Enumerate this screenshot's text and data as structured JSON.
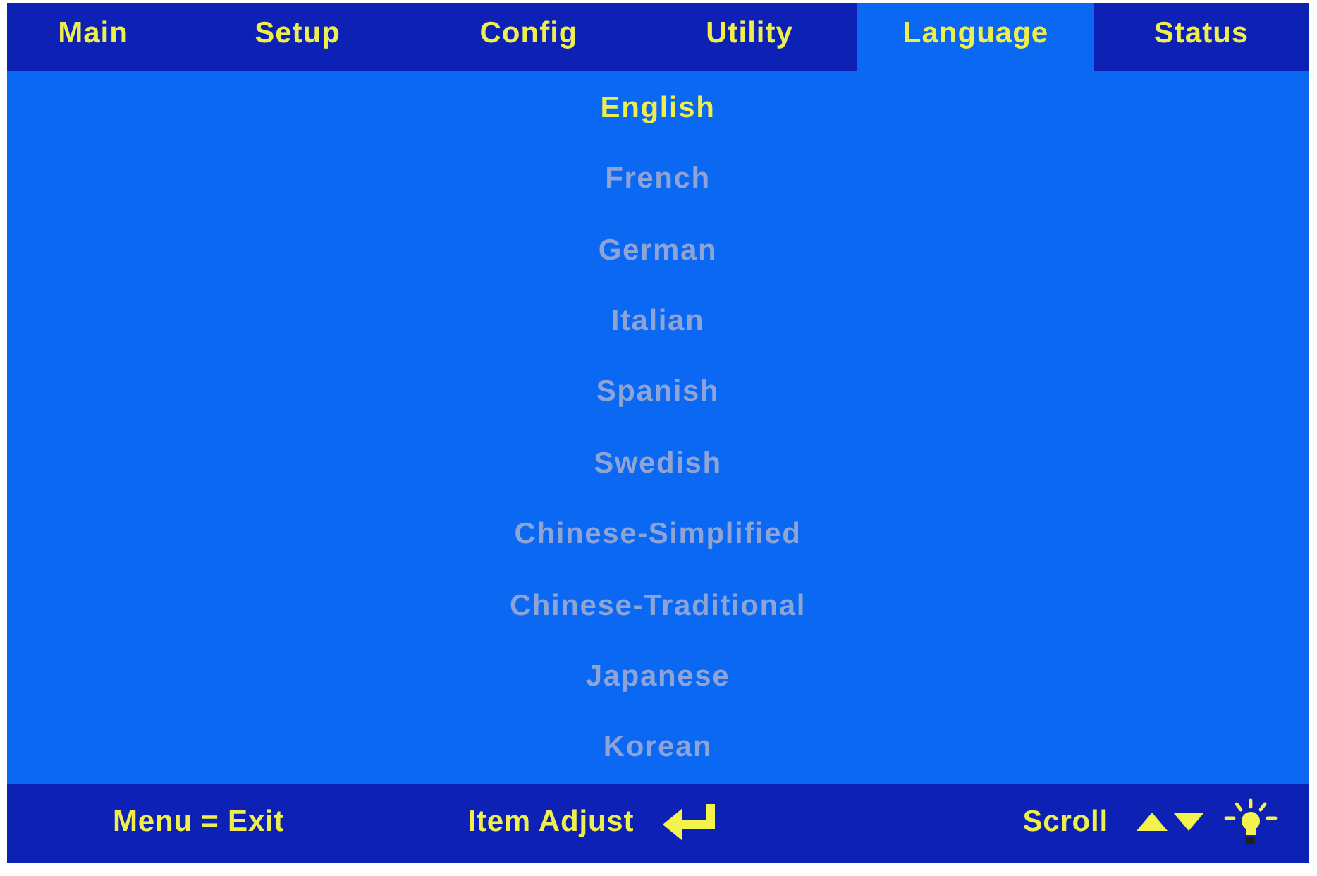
{
  "tabs": [
    {
      "label": "Main",
      "selected": false
    },
    {
      "label": "Setup",
      "selected": false
    },
    {
      "label": "Config",
      "selected": false
    },
    {
      "label": "Utility",
      "selected": false
    },
    {
      "label": "Language",
      "selected": true
    },
    {
      "label": "Status",
      "selected": false
    }
  ],
  "languages": [
    {
      "label": "English",
      "selected": true
    },
    {
      "label": "French",
      "selected": false
    },
    {
      "label": "German",
      "selected": false
    },
    {
      "label": "Italian",
      "selected": false
    },
    {
      "label": "Spanish",
      "selected": false
    },
    {
      "label": "Swedish",
      "selected": false
    },
    {
      "label": "Chinese-Simplified",
      "selected": false
    },
    {
      "label": "Chinese-Traditional",
      "selected": false
    },
    {
      "label": "Japanese",
      "selected": false
    },
    {
      "label": "Korean",
      "selected": false
    }
  ],
  "footer": {
    "menu_hint": "Menu = Exit",
    "adjust_hint": "Item Adjust",
    "scroll_hint": "Scroll"
  }
}
